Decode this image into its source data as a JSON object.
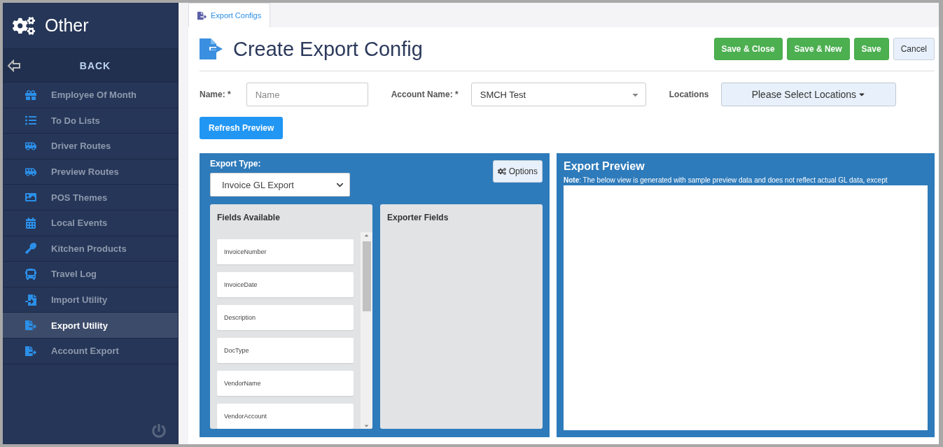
{
  "sidebar": {
    "title": "Other",
    "back": "BACK",
    "items": [
      {
        "label": "Employee Of Month",
        "selected": false
      },
      {
        "label": "To Do Lists",
        "selected": false
      },
      {
        "label": "Driver Routes",
        "selected": false
      },
      {
        "label": "Preview Routes",
        "selected": false
      },
      {
        "label": "POS Themes",
        "selected": false
      },
      {
        "label": "Local Events",
        "selected": false
      },
      {
        "label": "Kitchen Products",
        "selected": false
      },
      {
        "label": "Travel Log",
        "selected": false
      },
      {
        "label": "Import Utility",
        "selected": false
      },
      {
        "label": "Export Utility",
        "selected": true
      },
      {
        "label": "Account Export",
        "selected": false
      }
    ]
  },
  "tabs": [
    {
      "label": "Export Configs",
      "selected": true
    }
  ],
  "header": {
    "title": "Create Export Config",
    "buttons": [
      {
        "label": "Save & Close",
        "kind": "primary"
      },
      {
        "label": "Save & New",
        "kind": "primary"
      },
      {
        "label": "Save",
        "kind": "primary"
      },
      {
        "label": "Cancel",
        "kind": "secondary"
      }
    ]
  },
  "form": {
    "name_label": "Name: *",
    "name_placeholder": "Name",
    "account_label": "Account Name: *",
    "account_value": "SMCH Test",
    "locations_label": "Locations",
    "locations_button": "Please Select Locations",
    "refresh_button": "Refresh Preview"
  },
  "export_panel": {
    "type_label": "Export Type:",
    "type_value": "Invoice GL Export",
    "options_button": "Options",
    "available_title": "Fields Available",
    "available_fields": [
      "InvoiceNumber",
      "InvoiceDate",
      "Description",
      "DocType",
      "VendorName",
      "VendorAccount"
    ],
    "exporter_title": "Exporter Fields"
  },
  "preview": {
    "title": "Export Preview",
    "note_label": "Note",
    "note_text": ": The below view is generated with sample preview data and does not reflect actual GL data, except"
  }
}
